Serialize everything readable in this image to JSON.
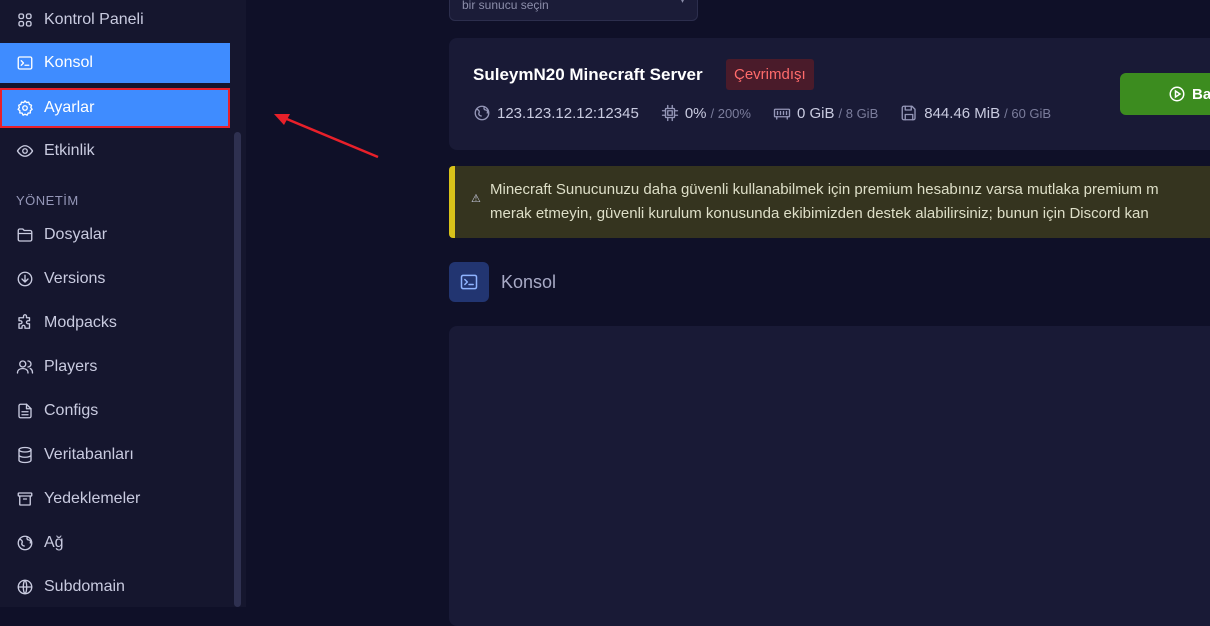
{
  "sidebar": {
    "items_top": [
      {
        "label": "Kontrol Paneli",
        "icon": "grid-icon"
      },
      {
        "label": "Konsol",
        "icon": "terminal-icon"
      },
      {
        "label": "Ayarlar",
        "icon": "gear-icon"
      },
      {
        "label": "Etkinlik",
        "icon": "eye-icon"
      }
    ],
    "section_label": "YÖNETİM",
    "items_management": [
      {
        "label": "Dosyalar",
        "icon": "folder-icon"
      },
      {
        "label": "Versions",
        "icon": "download-icon"
      },
      {
        "label": "Modpacks",
        "icon": "puzzle-icon"
      },
      {
        "label": "Players",
        "icon": "users-icon"
      },
      {
        "label": "Configs",
        "icon": "file-icon"
      },
      {
        "label": "Veritabanları",
        "icon": "database-icon"
      },
      {
        "label": "Yedeklemeler",
        "icon": "archive-icon"
      },
      {
        "label": "Ağ",
        "icon": "globe-icon"
      },
      {
        "label": "Subdomain",
        "icon": "globe-alt-icon"
      }
    ]
  },
  "selector": {
    "placeholder": "bir sunucu seçin"
  },
  "server": {
    "name": "SuleymN20 Minecraft Server",
    "status": "Çevrimdışı",
    "address": "123.123.12.12:12345",
    "cpu": "0%",
    "cpu_limit": "/ 200%",
    "memory": "0 GiB",
    "memory_limit": "/ 8 GiB",
    "disk": "844.46 MiB",
    "disk_limit": "/ 60 GiB",
    "start_label": "Ba"
  },
  "notice": {
    "line1": "Minecraft Sunucunuzu daha güvenli kullanabilmek için premium hesabınız varsa mutlaka premium m",
    "line2": "merak etmeyin, güvenli kurulum konusunda ekibimizden destek alabilirsiniz; bunun için Discord kan"
  },
  "console": {
    "title": "Konsol"
  },
  "colors": {
    "accent": "#3f8cff",
    "highlight_border": "#e8202a",
    "start_button": "#3c8c1f",
    "offline": "#ff6b6b"
  }
}
